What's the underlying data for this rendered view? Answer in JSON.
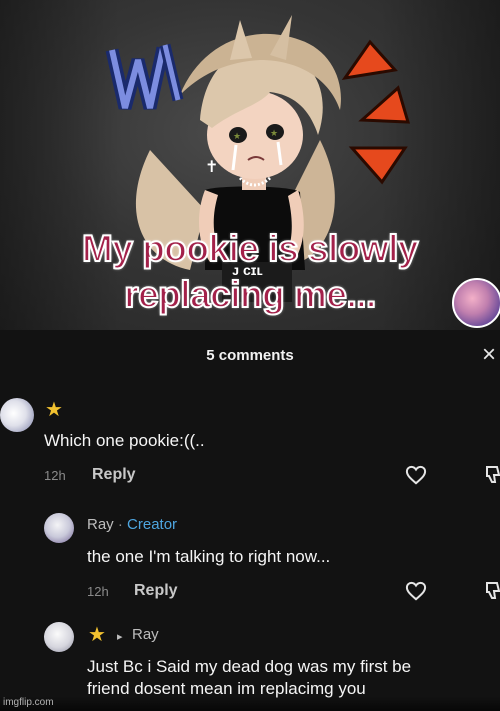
{
  "post": {
    "caption_line1": "My pookie is slowly",
    "caption_line2": "replacing me...",
    "accent_color": "#a3214a"
  },
  "comments_panel": {
    "header": "5 comments",
    "close_glyph": "×",
    "comments": [
      {
        "text": "Which one pookie:((..",
        "time": "12h",
        "reply_label": "Reply"
      },
      {
        "author": "Ray",
        "separator": "·",
        "badge": "Creator",
        "text": "the one I'm talking to right now...",
        "time": "12h",
        "reply_label": "Reply"
      },
      {
        "reply_glyph": "▸",
        "author": "Ray",
        "text_line1": "Just Bc i Said my dead dog was my first be",
        "text_line2": "friend dosent mean im replacimg you"
      }
    ]
  },
  "icons": {
    "star": "★",
    "heart": "heart-outline-icon",
    "dislike": "thumbs-down-outline-icon",
    "close": "close-icon"
  },
  "watermark": "imgflip.com"
}
